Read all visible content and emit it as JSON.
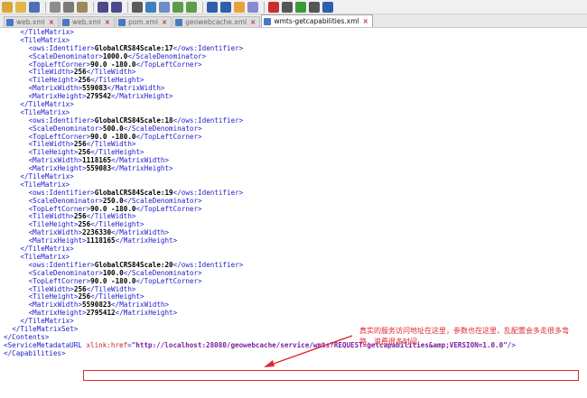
{
  "toolbar": {
    "icons": [
      "new-icon",
      "open-icon",
      "save-icon",
      "cut-icon",
      "copy-icon",
      "paste-icon",
      "undo-icon",
      "redo-icon",
      "print-icon",
      "find-icon",
      "replace-icon",
      "zoom-in-icon",
      "zoom-out-icon",
      "wrap-icon",
      "indent-icon",
      "format-icon",
      "view-icon",
      "record-icon",
      "stop-icon",
      "play-icon",
      "run-icon",
      "macro-icon"
    ]
  },
  "tabs": [
    {
      "label": "web.xml",
      "active": false
    },
    {
      "label": "web.xml",
      "active": false
    },
    {
      "label": "pom.xml",
      "active": false
    },
    {
      "label": "geowebcache.xml",
      "active": false
    },
    {
      "label": "wmts-getcapabilities.xml",
      "active": true
    }
  ],
  "code_lines": [
    {
      "indent": 4,
      "parts": [
        {
          "t": "tag",
          "v": "</TileMatrix>"
        }
      ]
    },
    {
      "indent": 4,
      "parts": [
        {
          "t": "tag",
          "v": "<TileMatrix>"
        }
      ]
    },
    {
      "indent": 6,
      "parts": [
        {
          "t": "tag",
          "v": "<ows:Identifier>"
        },
        {
          "t": "txt",
          "v": "GlobalCRS84Scale:17"
        },
        {
          "t": "tag",
          "v": "</ows:Identifier>"
        }
      ]
    },
    {
      "indent": 6,
      "parts": [
        {
          "t": "tag",
          "v": "<ScaleDenominator>"
        },
        {
          "t": "txt",
          "v": "1000.0"
        },
        {
          "t": "tag",
          "v": "</ScaleDenominator>"
        }
      ]
    },
    {
      "indent": 6,
      "parts": [
        {
          "t": "tag",
          "v": "<TopLeftCorner>"
        },
        {
          "t": "txt",
          "v": "90.0 -180.0"
        },
        {
          "t": "tag",
          "v": "</TopLeftCorner>"
        }
      ]
    },
    {
      "indent": 6,
      "parts": [
        {
          "t": "tag",
          "v": "<TileWidth>"
        },
        {
          "t": "txt",
          "v": "256"
        },
        {
          "t": "tag",
          "v": "</TileWidth>"
        }
      ]
    },
    {
      "indent": 6,
      "parts": [
        {
          "t": "tag",
          "v": "<TileHeight>"
        },
        {
          "t": "txt",
          "v": "256"
        },
        {
          "t": "tag",
          "v": "</TileHeight>"
        }
      ]
    },
    {
      "indent": 6,
      "parts": [
        {
          "t": "tag",
          "v": "<MatrixWidth>"
        },
        {
          "t": "txt",
          "v": "559083"
        },
        {
          "t": "tag",
          "v": "</MatrixWidth>"
        }
      ]
    },
    {
      "indent": 6,
      "parts": [
        {
          "t": "tag",
          "v": "<MatrixHeight>"
        },
        {
          "t": "txt",
          "v": "279542"
        },
        {
          "t": "tag",
          "v": "</MatrixHeight>"
        }
      ]
    },
    {
      "indent": 4,
      "parts": [
        {
          "t": "tag",
          "v": "</TileMatrix>"
        }
      ]
    },
    {
      "indent": 4,
      "parts": [
        {
          "t": "tag",
          "v": "<TileMatrix>"
        }
      ]
    },
    {
      "indent": 6,
      "parts": [
        {
          "t": "tag",
          "v": "<ows:Identifier>"
        },
        {
          "t": "txt",
          "v": "GlobalCRS84Scale:18"
        },
        {
          "t": "tag",
          "v": "</ows:Identifier>"
        }
      ]
    },
    {
      "indent": 6,
      "parts": [
        {
          "t": "tag",
          "v": "<ScaleDenominator>"
        },
        {
          "t": "txt",
          "v": "500.0"
        },
        {
          "t": "tag",
          "v": "</ScaleDenominator>"
        }
      ]
    },
    {
      "indent": 6,
      "parts": [
        {
          "t": "tag",
          "v": "<TopLeftCorner>"
        },
        {
          "t": "txt",
          "v": "90.0 -180.0"
        },
        {
          "t": "tag",
          "v": "</TopLeftCorner>"
        }
      ]
    },
    {
      "indent": 6,
      "parts": [
        {
          "t": "tag",
          "v": "<TileWidth>"
        },
        {
          "t": "txt",
          "v": "256"
        },
        {
          "t": "tag",
          "v": "</TileWidth>"
        }
      ]
    },
    {
      "indent": 6,
      "parts": [
        {
          "t": "tag",
          "v": "<TileHeight>"
        },
        {
          "t": "txt",
          "v": "256"
        },
        {
          "t": "tag",
          "v": "</TileHeight>"
        }
      ]
    },
    {
      "indent": 6,
      "parts": [
        {
          "t": "tag",
          "v": "<MatrixWidth>"
        },
        {
          "t": "txt",
          "v": "1118165"
        },
        {
          "t": "tag",
          "v": "</MatrixWidth>"
        }
      ]
    },
    {
      "indent": 6,
      "parts": [
        {
          "t": "tag",
          "v": "<MatrixHeight>"
        },
        {
          "t": "txt",
          "v": "559083"
        },
        {
          "t": "tag",
          "v": "</MatrixHeight>"
        }
      ]
    },
    {
      "indent": 4,
      "parts": [
        {
          "t": "tag",
          "v": "</TileMatrix>"
        }
      ]
    },
    {
      "indent": 4,
      "parts": [
        {
          "t": "tag",
          "v": "<TileMatrix>"
        }
      ]
    },
    {
      "indent": 6,
      "parts": [
        {
          "t": "tag",
          "v": "<ows:Identifier>"
        },
        {
          "t": "txt",
          "v": "GlobalCRS84Scale:19"
        },
        {
          "t": "tag",
          "v": "</ows:Identifier>"
        }
      ]
    },
    {
      "indent": 6,
      "parts": [
        {
          "t": "tag",
          "v": "<ScaleDenominator>"
        },
        {
          "t": "txt",
          "v": "250.0"
        },
        {
          "t": "tag",
          "v": "</ScaleDenominator>"
        }
      ]
    },
    {
      "indent": 6,
      "parts": [
        {
          "t": "tag",
          "v": "<TopLeftCorner>"
        },
        {
          "t": "txt",
          "v": "90.0 -180.0"
        },
        {
          "t": "tag",
          "v": "</TopLeftCorner>"
        }
      ]
    },
    {
      "indent": 6,
      "parts": [
        {
          "t": "tag",
          "v": "<TileWidth>"
        },
        {
          "t": "txt",
          "v": "256"
        },
        {
          "t": "tag",
          "v": "</TileWidth>"
        }
      ]
    },
    {
      "indent": 6,
      "parts": [
        {
          "t": "tag",
          "v": "<TileHeight>"
        },
        {
          "t": "txt",
          "v": "256"
        },
        {
          "t": "tag",
          "v": "</TileHeight>"
        }
      ]
    },
    {
      "indent": 6,
      "parts": [
        {
          "t": "tag",
          "v": "<MatrixWidth>"
        },
        {
          "t": "txt",
          "v": "2236330"
        },
        {
          "t": "tag",
          "v": "</MatrixWidth>"
        }
      ]
    },
    {
      "indent": 6,
      "parts": [
        {
          "t": "tag",
          "v": "<MatrixHeight>"
        },
        {
          "t": "txt",
          "v": "1118165"
        },
        {
          "t": "tag",
          "v": "</MatrixHeight>"
        }
      ]
    },
    {
      "indent": 4,
      "parts": [
        {
          "t": "tag",
          "v": "</TileMatrix>"
        }
      ]
    },
    {
      "indent": 4,
      "parts": [
        {
          "t": "tag",
          "v": "<TileMatrix>"
        }
      ]
    },
    {
      "indent": 6,
      "parts": [
        {
          "t": "tag",
          "v": "<ows:Identifier>"
        },
        {
          "t": "txt",
          "v": "GlobalCRS84Scale:20"
        },
        {
          "t": "tag",
          "v": "</ows:Identifier>"
        }
      ]
    },
    {
      "indent": 6,
      "parts": [
        {
          "t": "tag",
          "v": "<ScaleDenominator>"
        },
        {
          "t": "txt",
          "v": "100.0"
        },
        {
          "t": "tag",
          "v": "</ScaleDenominator>"
        }
      ]
    },
    {
      "indent": 6,
      "parts": [
        {
          "t": "tag",
          "v": "<TopLeftCorner>"
        },
        {
          "t": "txt",
          "v": "90.0 -180.0"
        },
        {
          "t": "tag",
          "v": "</TopLeftCorner>"
        }
      ]
    },
    {
      "indent": 6,
      "parts": [
        {
          "t": "tag",
          "v": "<TileWidth>"
        },
        {
          "t": "txt",
          "v": "256"
        },
        {
          "t": "tag",
          "v": "</TileWidth>"
        }
      ]
    },
    {
      "indent": 6,
      "parts": [
        {
          "t": "tag",
          "v": "<TileHeight>"
        },
        {
          "t": "txt",
          "v": "256"
        },
        {
          "t": "tag",
          "v": "</TileHeight>"
        }
      ]
    },
    {
      "indent": 6,
      "parts": [
        {
          "t": "tag",
          "v": "<MatrixWidth>"
        },
        {
          "t": "txt",
          "v": "5590823"
        },
        {
          "t": "tag",
          "v": "</MatrixWidth>"
        }
      ]
    },
    {
      "indent": 6,
      "parts": [
        {
          "t": "tag",
          "v": "<MatrixHeight>"
        },
        {
          "t": "txt",
          "v": "2795412"
        },
        {
          "t": "tag",
          "v": "</MatrixHeight>"
        }
      ]
    },
    {
      "indent": 4,
      "parts": [
        {
          "t": "tag",
          "v": "</TileMatrix>"
        }
      ]
    },
    {
      "indent": 2,
      "parts": [
        {
          "t": "tag",
          "v": "</TileMatrixSet>"
        }
      ]
    },
    {
      "indent": 0,
      "parts": [
        {
          "t": "tag",
          "v": "</Contents>"
        }
      ]
    },
    {
      "indent": 0,
      "parts": [
        {
          "t": "tag",
          "v": "<ServiceMetadataURL "
        },
        {
          "t": "attr",
          "v": "xlink:href"
        },
        {
          "t": "tag",
          "v": "="
        },
        {
          "t": "val",
          "v": "\"http://localhost:28080/geowebcache/service/wmts?REQUEST=getcapabilities&amp;VERSION=1.0.0\""
        },
        {
          "t": "tag",
          "v": "/>"
        }
      ]
    },
    {
      "indent": 0,
      "parts": [
        {
          "t": "tag",
          "v": "</Capabilities>"
        }
      ]
    }
  ],
  "annotation": {
    "text": "真实的服务访问地址在这里，参数也在这里，乱配置会多走很多弯路，浪费很多时间"
  },
  "colors": {
    "tag": "#1c1cc8",
    "text": "#000000",
    "attr": "#cc2222",
    "value": "#7a1fa0",
    "annotation": "#e0282e"
  }
}
